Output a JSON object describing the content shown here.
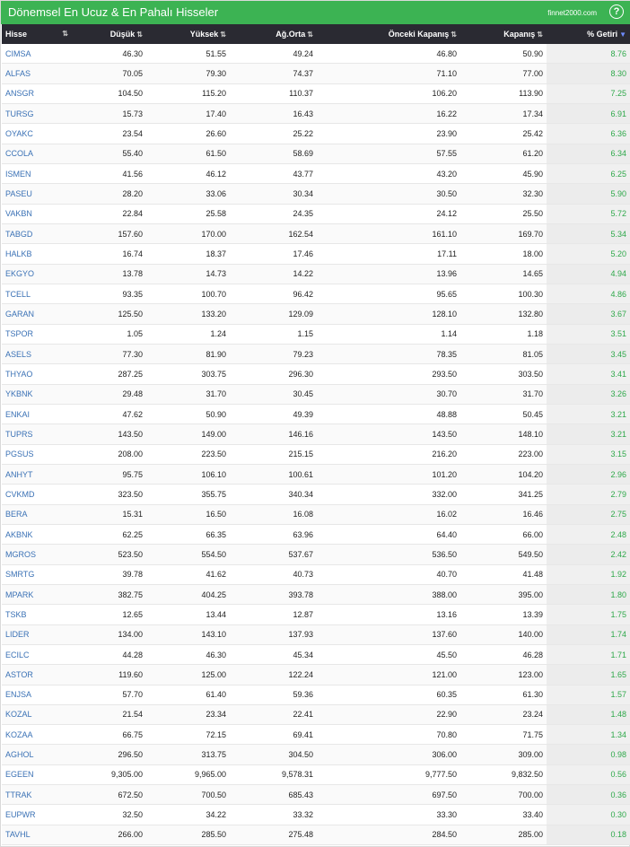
{
  "header": {
    "title": "Dönemsel En Ucuz & En Pahalı Hisseler",
    "brand": "finnet2000.com",
    "help_label": "?"
  },
  "columns": [
    {
      "label": "Hisse",
      "sort": "⇅"
    },
    {
      "label": "Düşük",
      "sort": "⇅"
    },
    {
      "label": "Yüksek",
      "sort": "⇅"
    },
    {
      "label": "Ağ.Orta",
      "sort": "⇅"
    },
    {
      "label": "Önceki Kapanış",
      "sort": "⇅"
    },
    {
      "label": "Kapanış",
      "sort": "⇅"
    },
    {
      "label": "% Getiri",
      "sort": "▼"
    }
  ],
  "rows": [
    [
      "CIMSA",
      "46.30",
      "51.55",
      "49.24",
      "46.80",
      "50.90",
      "8.76"
    ],
    [
      "ALFAS",
      "70.05",
      "79.30",
      "74.37",
      "71.10",
      "77.00",
      "8.30"
    ],
    [
      "ANSGR",
      "104.50",
      "115.20",
      "110.37",
      "106.20",
      "113.90",
      "7.25"
    ],
    [
      "TURSG",
      "15.73",
      "17.40",
      "16.43",
      "16.22",
      "17.34",
      "6.91"
    ],
    [
      "OYAKC",
      "23.54",
      "26.60",
      "25.22",
      "23.90",
      "25.42",
      "6.36"
    ],
    [
      "CCOLA",
      "55.40",
      "61.50",
      "58.69",
      "57.55",
      "61.20",
      "6.34"
    ],
    [
      "ISMEN",
      "41.56",
      "46.12",
      "43.77",
      "43.20",
      "45.90",
      "6.25"
    ],
    [
      "PASEU",
      "28.20",
      "33.06",
      "30.34",
      "30.50",
      "32.30",
      "5.90"
    ],
    [
      "VAKBN",
      "22.84",
      "25.58",
      "24.35",
      "24.12",
      "25.50",
      "5.72"
    ],
    [
      "TABGD",
      "157.60",
      "170.00",
      "162.54",
      "161.10",
      "169.70",
      "5.34"
    ],
    [
      "HALKB",
      "16.74",
      "18.37",
      "17.46",
      "17.11",
      "18.00",
      "5.20"
    ],
    [
      "EKGYO",
      "13.78",
      "14.73",
      "14.22",
      "13.96",
      "14.65",
      "4.94"
    ],
    [
      "TCELL",
      "93.35",
      "100.70",
      "96.42",
      "95.65",
      "100.30",
      "4.86"
    ],
    [
      "GARAN",
      "125.50",
      "133.20",
      "129.09",
      "128.10",
      "132.80",
      "3.67"
    ],
    [
      "TSPOR",
      "1.05",
      "1.24",
      "1.15",
      "1.14",
      "1.18",
      "3.51"
    ],
    [
      "ASELS",
      "77.30",
      "81.90",
      "79.23",
      "78.35",
      "81.05",
      "3.45"
    ],
    [
      "THYAO",
      "287.25",
      "303.75",
      "296.30",
      "293.50",
      "303.50",
      "3.41"
    ],
    [
      "YKBNK",
      "29.48",
      "31.70",
      "30.45",
      "30.70",
      "31.70",
      "3.26"
    ],
    [
      "ENKAI",
      "47.62",
      "50.90",
      "49.39",
      "48.88",
      "50.45",
      "3.21"
    ],
    [
      "TUPRS",
      "143.50",
      "149.00",
      "146.16",
      "143.50",
      "148.10",
      "3.21"
    ],
    [
      "PGSUS",
      "208.00",
      "223.50",
      "215.15",
      "216.20",
      "223.00",
      "3.15"
    ],
    [
      "ANHYT",
      "95.75",
      "106.10",
      "100.61",
      "101.20",
      "104.20",
      "2.96"
    ],
    [
      "CVKMD",
      "323.50",
      "355.75",
      "340.34",
      "332.00",
      "341.25",
      "2.79"
    ],
    [
      "BERA",
      "15.31",
      "16.50",
      "16.08",
      "16.02",
      "16.46",
      "2.75"
    ],
    [
      "AKBNK",
      "62.25",
      "66.35",
      "63.96",
      "64.40",
      "66.00",
      "2.48"
    ],
    [
      "MGROS",
      "523.50",
      "554.50",
      "537.67",
      "536.50",
      "549.50",
      "2.42"
    ],
    [
      "SMRTG",
      "39.78",
      "41.62",
      "40.73",
      "40.70",
      "41.48",
      "1.92"
    ],
    [
      "MPARK",
      "382.75",
      "404.25",
      "393.78",
      "388.00",
      "395.00",
      "1.80"
    ],
    [
      "TSKB",
      "12.65",
      "13.44",
      "12.87",
      "13.16",
      "13.39",
      "1.75"
    ],
    [
      "LIDER",
      "134.00",
      "143.10",
      "137.93",
      "137.60",
      "140.00",
      "1.74"
    ],
    [
      "ECILC",
      "44.28",
      "46.30",
      "45.34",
      "45.50",
      "46.28",
      "1.71"
    ],
    [
      "ASTOR",
      "119.60",
      "125.00",
      "122.24",
      "121.00",
      "123.00",
      "1.65"
    ],
    [
      "ENJSA",
      "57.70",
      "61.40",
      "59.36",
      "60.35",
      "61.30",
      "1.57"
    ],
    [
      "KOZAL",
      "21.54",
      "23.34",
      "22.41",
      "22.90",
      "23.24",
      "1.48"
    ],
    [
      "KOZAA",
      "66.75",
      "72.15",
      "69.41",
      "70.80",
      "71.75",
      "1.34"
    ],
    [
      "AGHOL",
      "296.50",
      "313.75",
      "304.50",
      "306.00",
      "309.00",
      "0.98"
    ],
    [
      "EGEEN",
      "9,305.00",
      "9,965.00",
      "9,578.31",
      "9,777.50",
      "9,832.50",
      "0.56"
    ],
    [
      "TTRAK",
      "672.50",
      "700.50",
      "685.43",
      "697.50",
      "700.00",
      "0.36"
    ],
    [
      "EUPWR",
      "32.50",
      "34.22",
      "33.32",
      "33.30",
      "33.40",
      "0.30"
    ],
    [
      "TAVHL",
      "266.00",
      "285.50",
      "275.48",
      "284.50",
      "285.00",
      "0.18"
    ]
  ]
}
